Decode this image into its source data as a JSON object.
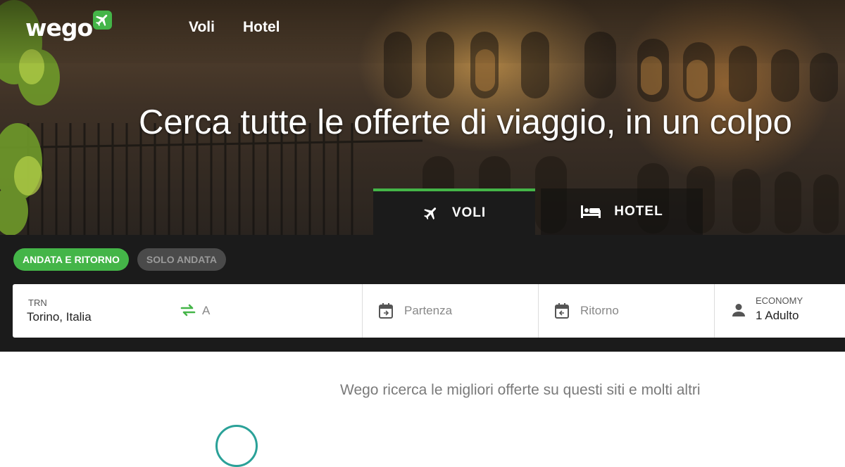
{
  "brand": {
    "logo_text": "wego",
    "accent_color": "#44b548"
  },
  "nav": {
    "items": [
      "Voli",
      "Hotel"
    ]
  },
  "hero": {
    "headline": "Cerca tutte le offerte di viaggio, in un colpo"
  },
  "tabs": [
    {
      "label": "VOLI",
      "icon": "airplane-icon",
      "active": true
    },
    {
      "label": "HOTEL",
      "icon": "bed-icon",
      "active": false
    }
  ],
  "trip_type": {
    "options": [
      "ANDATA E RITORNO",
      "SOLO ANDATA"
    ],
    "selected": "ANDATA E RITORNO"
  },
  "search": {
    "origin_code": "TRN",
    "origin_city": "Torino, Italia",
    "swap_icon": "swap-arrows-icon",
    "destination_placeholder": "A",
    "departure_placeholder": "Partenza",
    "return_placeholder": "Ritorno",
    "cabin_class": "ECONOMY",
    "passengers": "1 Adulto",
    "calendar_icon": "calendar-icon",
    "person_icon": "person-icon"
  },
  "footer": {
    "tagline": "Wego ricerca le migliori offerte su questi siti e molti altri"
  }
}
